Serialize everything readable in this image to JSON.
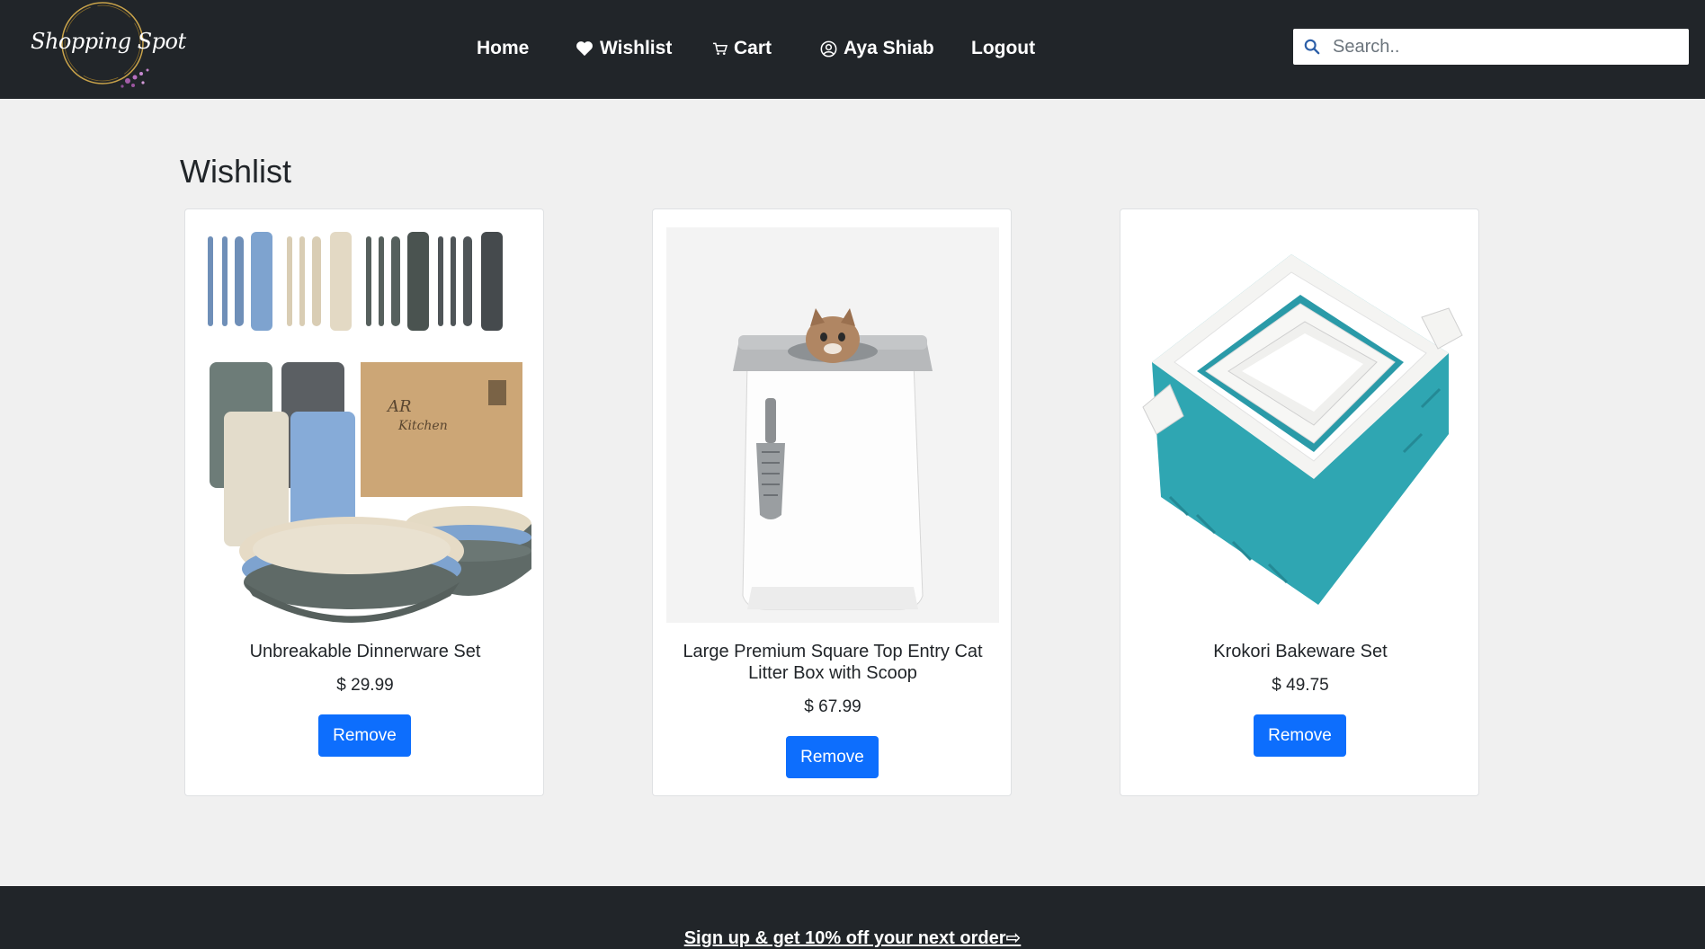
{
  "brand": {
    "logo_text": "Shopping Spot"
  },
  "nav": {
    "home": "Home",
    "wishlist": "Wishlist",
    "cart": "Cart",
    "user": "Aya Shiab",
    "logout": "Logout"
  },
  "search": {
    "placeholder": "Search.."
  },
  "page": {
    "title": "Wishlist"
  },
  "items": [
    {
      "name": "Unbreakable Dinnerware Set",
      "currency": "$",
      "price": "29.99",
      "action": "Remove",
      "image": "dinnerware-set-image"
    },
    {
      "name": "Large Premium Square Top Entry Cat Litter Box with Scoop",
      "currency": "$",
      "price": "67.99",
      "action": "Remove",
      "image": "cat-litter-box-image"
    },
    {
      "name": "Krokori Bakeware Set",
      "currency": "$",
      "price": "49.75",
      "action": "Remove",
      "image": "bakeware-set-image"
    }
  ],
  "footer": {
    "signup_text": "Sign up & get 10% off your next order",
    "arrow": "⇨"
  },
  "colors": {
    "nav_bg": "#212529",
    "page_bg": "#f0f0f0",
    "primary": "#0d6efd"
  }
}
